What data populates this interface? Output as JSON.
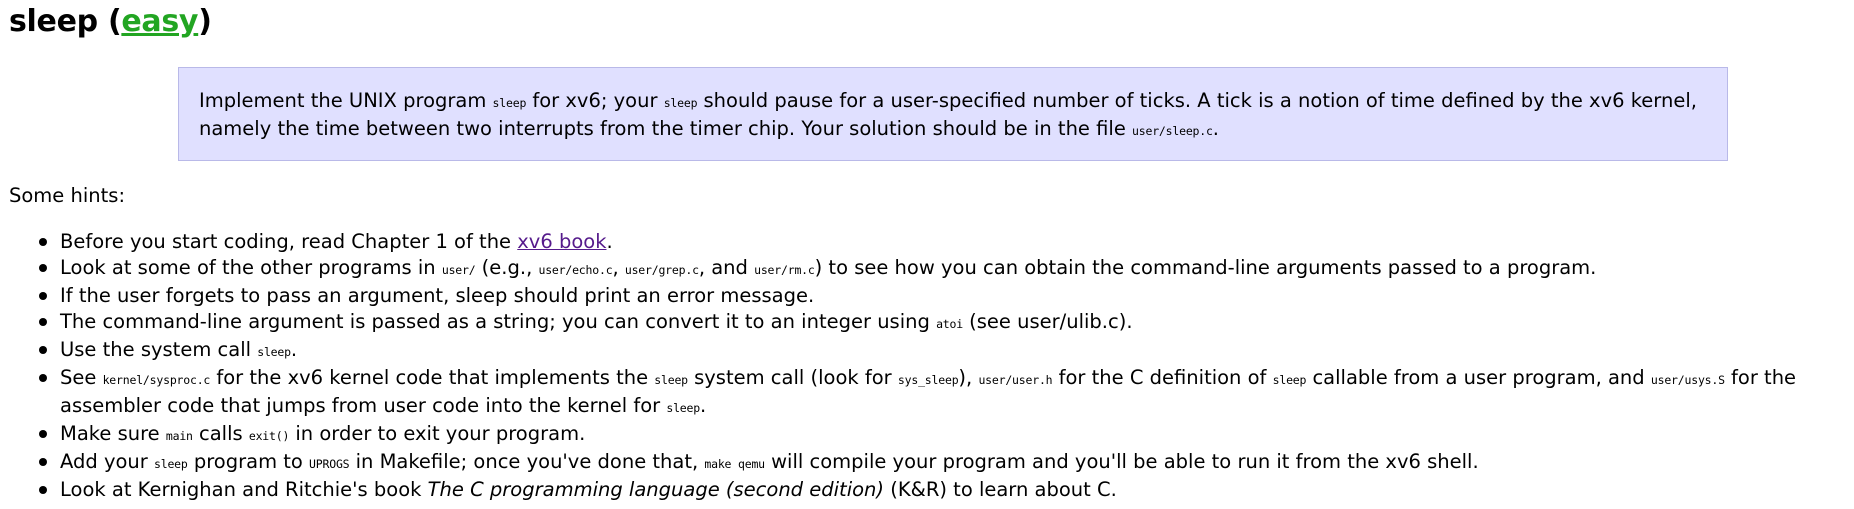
{
  "heading": {
    "prefix": "sleep (",
    "difficulty": "easy",
    "suffix": ")",
    "difficulty_color": "#22a522"
  },
  "assignment": {
    "background": "#e0e0ff",
    "t1": "Implement the UNIX program ",
    "c1": "sleep",
    "t2": " for xv6; your ",
    "c2": "sleep",
    "t3": " should pause for a user-specified number of ticks. A tick is a notion of time defined by the xv6 kernel, namely the time between two interrupts from the timer chip. Your solution should be in the file ",
    "c3": "user/sleep.c",
    "t4": "."
  },
  "hints_intro": "Some hints:",
  "hints": [
    {
      "t1": "Before you start coding, read Chapter 1 of the ",
      "link": "xv6 book",
      "t2": "."
    },
    {
      "t1": "Look at some of the other programs in ",
      "c1": "user/",
      "t2": " (e.g., ",
      "c2": "user/echo.c",
      "t3": ", ",
      "c3": "user/grep.c",
      "t4": ", and ",
      "c4": "user/rm.c",
      "t5": ") to see how you can obtain the command-line arguments passed to a program."
    },
    {
      "t1": "If the user forgets to pass an argument, sleep should print an error message."
    },
    {
      "t1": "The command-line argument is passed as a string; you can convert it to an integer using ",
      "c1": "atoi",
      "t2": " (see user/ulib.c)."
    },
    {
      "t1": "Use the system call ",
      "c1": "sleep",
      "t2": "."
    },
    {
      "t1": "See ",
      "c1": "kernel/sysproc.c",
      "t2": " for the xv6 kernel code that implements the ",
      "c2": "sleep",
      "t3": " system call (look for ",
      "c3": "sys_sleep",
      "t4": "), ",
      "c4": "user/user.h",
      "t5": " for the C definition of ",
      "c5": "sleep",
      "t6": " callable from a user program, and ",
      "c6": "user/usys.S",
      "t7": " for the assembler code that jumps from user code into the kernel for ",
      "c7": "sleep",
      "t8": "."
    },
    {
      "t1": "Make sure ",
      "c1": "main",
      "t2": " calls ",
      "c2": "exit()",
      "t3": " in order to exit your program."
    },
    {
      "t1": "Add your ",
      "c1": "sleep",
      "t2": " program to ",
      "c2": "UPROGS",
      "t3": " in Makefile; once you've done that, ",
      "c3": "make qemu",
      "t4": " will compile your program and you'll be able to run it from the xv6 shell."
    },
    {
      "t1": "Look at Kernighan and Ritchie's book ",
      "em": "The C programming language (second edition)",
      "t2": " (K&R) to learn about C."
    }
  ]
}
